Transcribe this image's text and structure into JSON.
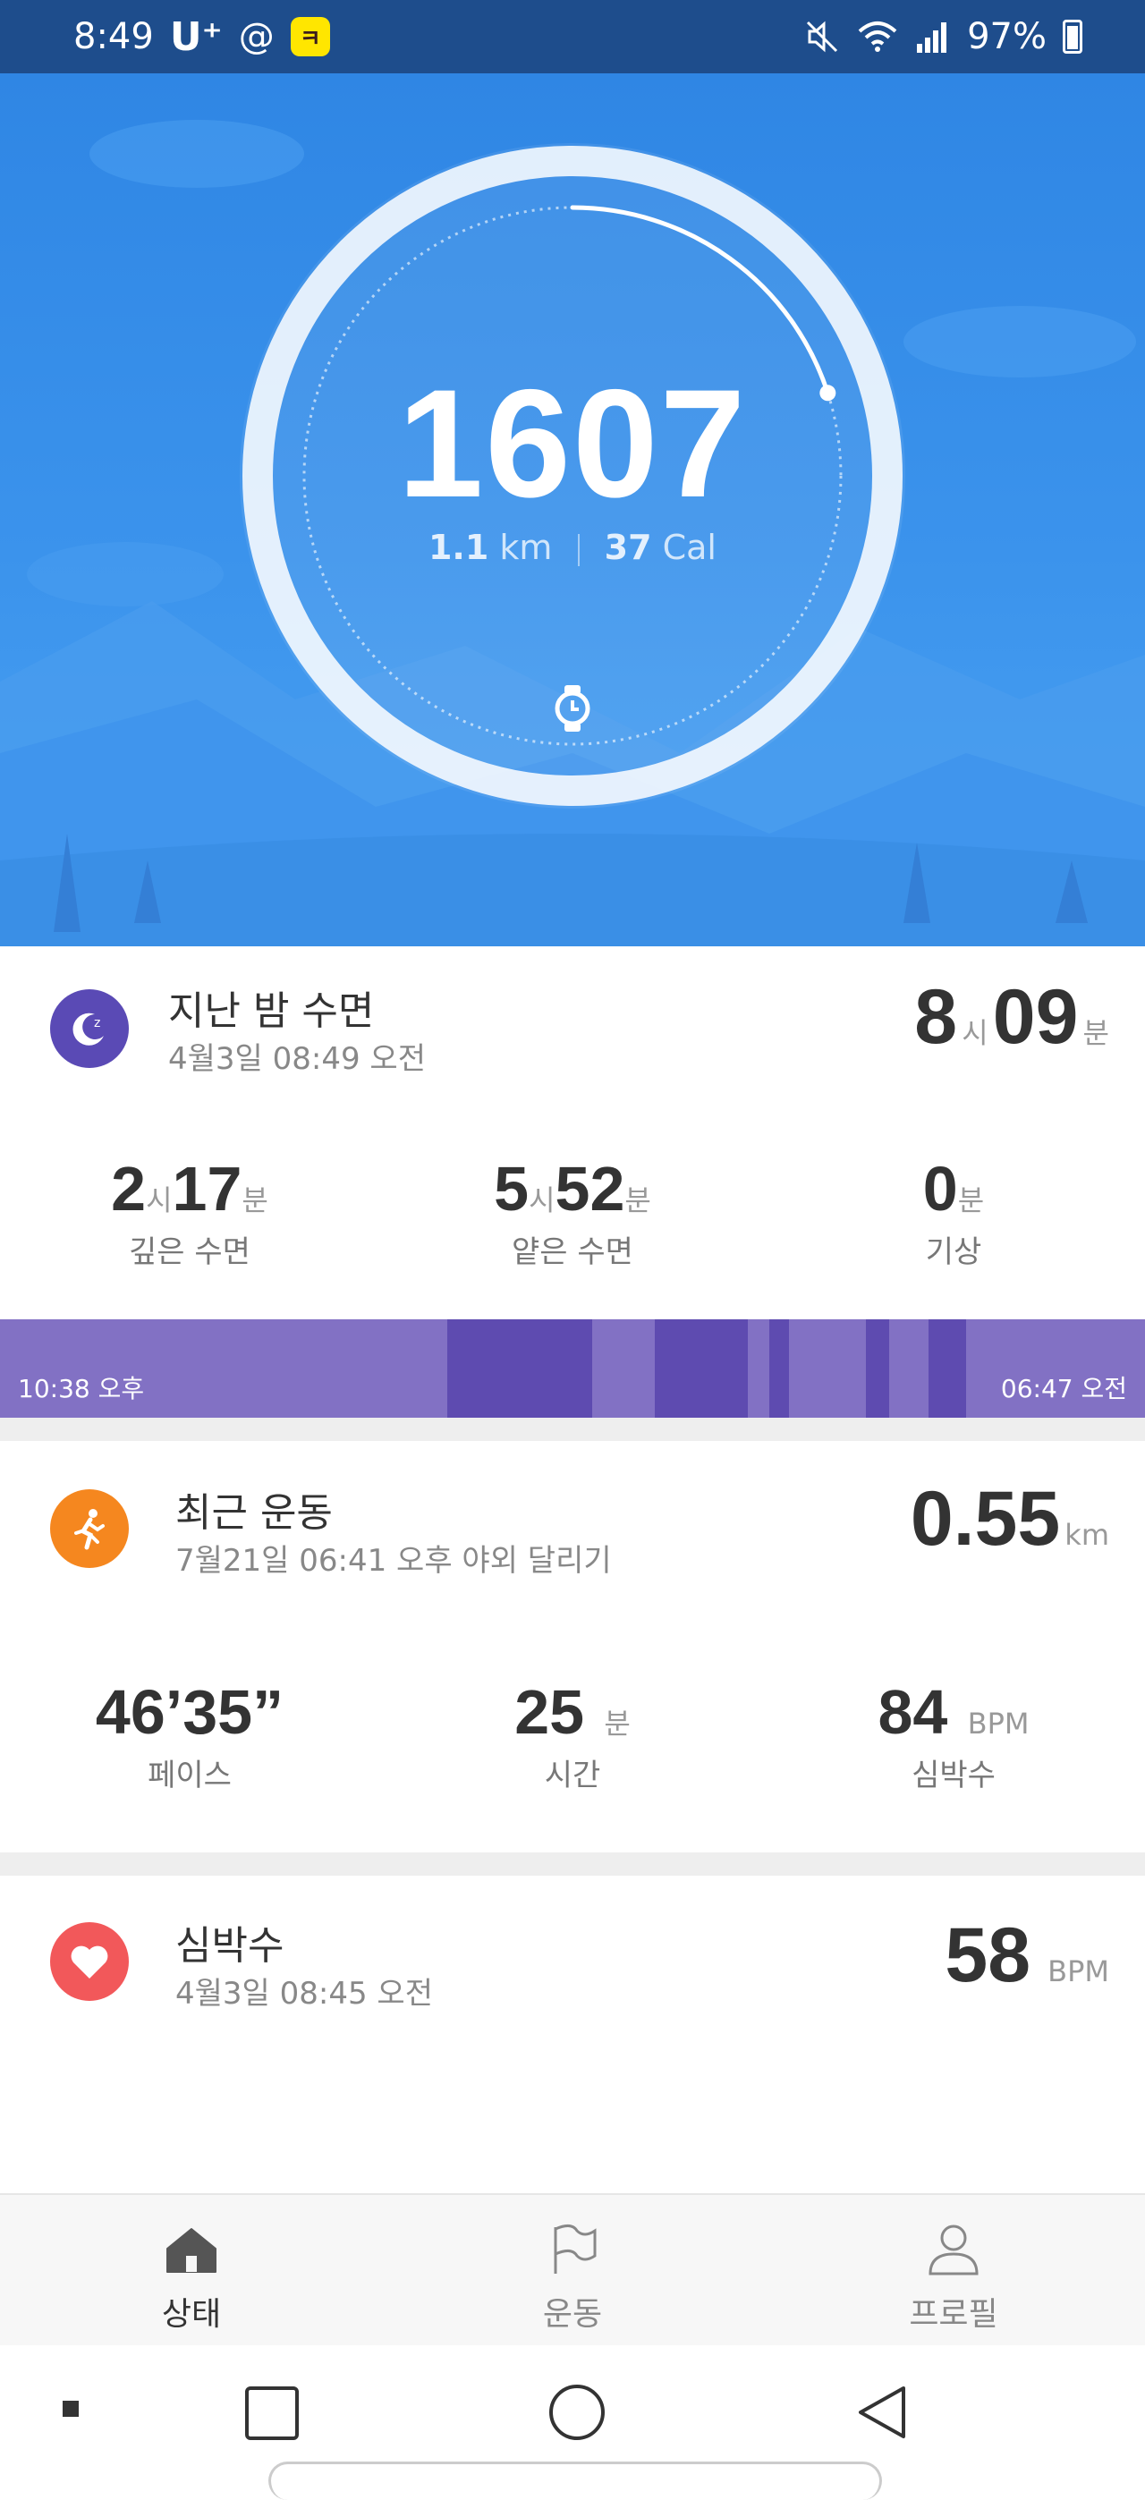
{
  "status_bar": {
    "time": "8:49",
    "carrier": "U⁺",
    "at": "@",
    "kakao": "ㅋ",
    "battery": "97%"
  },
  "hero": {
    "steps": "1607",
    "distance_value": "1.1",
    "distance_unit": "km",
    "calories_value": "37",
    "calories_unit": "Cal",
    "step_goal_progress": 0.2
  },
  "sleep": {
    "title": "지난 밤 수면",
    "subtitle": "4월3일 08:49 오전",
    "total_hours": "8",
    "hour_unit": "시",
    "total_minutes": "09",
    "minute_unit": "분",
    "stats": [
      {
        "h": "2",
        "hu": "시",
        "m": "17",
        "mu": "분",
        "label": "깊은 수면"
      },
      {
        "h": "5",
        "hu": "시",
        "m": "52",
        "mu": "분",
        "label": "얕은 수면"
      },
      {
        "m": "0",
        "mu": "분",
        "label": "기상"
      }
    ],
    "start_time": "10:38 오후",
    "end_time": "06:47 오전"
  },
  "workout": {
    "title": "최근 운동",
    "subtitle": "7월21일 06:41 오후 야외 달리기",
    "distance": "0.55",
    "distance_unit": "km",
    "stats": [
      {
        "value": "46’35”",
        "unit": "",
        "label": "페이스"
      },
      {
        "value": "25",
        "unit": "분",
        "label": "시간"
      },
      {
        "value": "84",
        "unit": "BPM",
        "label": "심박수"
      }
    ]
  },
  "heart": {
    "title": "심박수",
    "subtitle": "4월3일 08:45 오전",
    "value": "58",
    "unit": "BPM"
  },
  "tabs": [
    {
      "label": "상태",
      "icon": "home-icon",
      "active": true
    },
    {
      "label": "운동",
      "icon": "flag-icon",
      "active": false
    },
    {
      "label": "프로필",
      "icon": "person-icon",
      "active": false
    }
  ],
  "colors": {
    "hero_blue": "#2f86e4",
    "sleep_purple": "#5a4ab5",
    "workout_orange": "#f5871f",
    "heart_red": "#f2585a"
  }
}
